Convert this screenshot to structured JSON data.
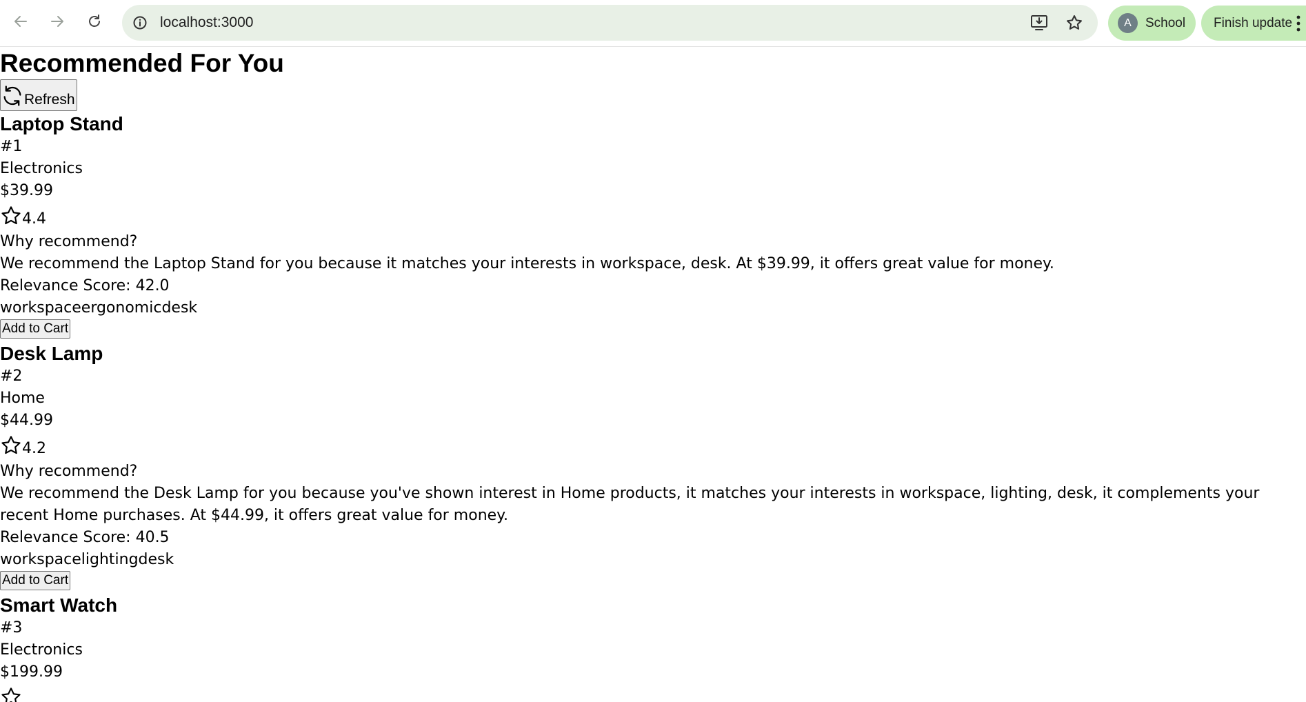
{
  "browser": {
    "url": "localhost:3000",
    "profile_initial": "A",
    "profile_label": "School",
    "update_label": "Finish update",
    "chip_color": "#c4ebb7",
    "omnibox_color": "#e8f0e6"
  },
  "page": {
    "title": "Recommended For You",
    "refresh_label": "Refresh",
    "products": [
      {
        "name": "Laptop Stand",
        "rank": "#1",
        "category": "Electronics",
        "price": "$39.99",
        "rating": "4.4",
        "why_label": "Why recommend?",
        "explanation": "We recommend the Laptop Stand for you because it matches your interests in workspace, desk. At $39.99, it offers great value for money.",
        "relevance": "Relevance Score: 42.0",
        "tags": "workspaceergonomicdesk",
        "cart_label": "Add to Cart"
      },
      {
        "name": "Desk Lamp",
        "rank": "#2",
        "category": "Home",
        "price": "$44.99",
        "rating": "4.2",
        "why_label": "Why recommend?",
        "explanation": "We recommend the Desk Lamp for you because you've shown interest in Home products, it matches your interests in workspace, lighting, desk, it complements your recent Home purchases. At $44.99, it offers great value for money.",
        "relevance": "Relevance Score: 40.5",
        "tags": "workspacelightingdesk",
        "cart_label": "Add to Cart"
      },
      {
        "name": "Smart Watch",
        "rank": "#3",
        "category": "Electronics",
        "price": "$199.99"
      }
    ]
  }
}
